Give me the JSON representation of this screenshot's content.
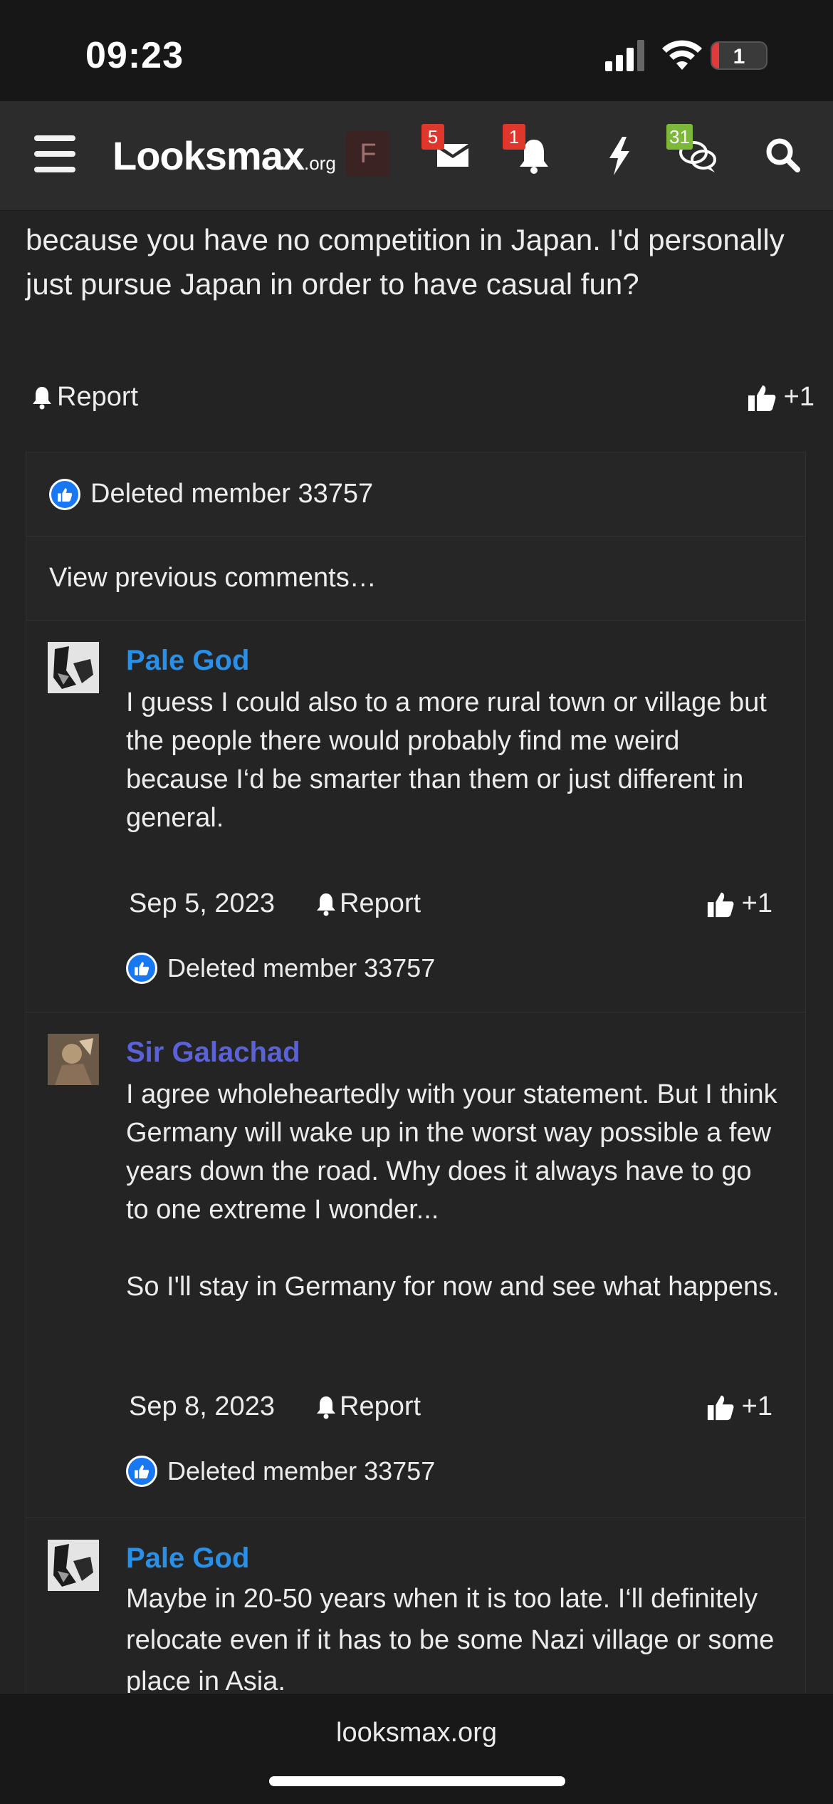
{
  "status_bar": {
    "time": "09:23",
    "battery": "1"
  },
  "nav": {
    "logo_main": "Looksmax",
    "logo_suffix": ".org",
    "avatar_letter": "F",
    "badges": {
      "messages": "5",
      "alerts": "1",
      "new_posts": "31"
    }
  },
  "post": {
    "text": "because you have no competition in Japan. I'd personally just pursue Japan in order to have casual fun?",
    "report_label": "Report",
    "like_count": "+1",
    "liked_by": "Deleted member 33757"
  },
  "comments_section": {
    "view_previous": "View previous comments…",
    "comments": [
      {
        "author": "Pale God",
        "body": "I guess I could also to a more rural town or village but the people there would probably find me weird because I‘d be smarter than them or just different in general.",
        "date": "Sep 5, 2023",
        "report_label": "Report",
        "like_count": "+1",
        "liked_by": "Deleted member 33757"
      },
      {
        "author": "Sir Galachad",
        "body": "I agree wholeheartedly with your statement. But I think Germany will wake up in the worst way possible a few years down the road. Why does it always have to go to one extreme I wonder...\n\nSo I'll stay in Germany for now and see what happens.",
        "date": "Sep 8, 2023",
        "report_label": "Report",
        "like_count": "+1",
        "liked_by": "Deleted member 33757"
      },
      {
        "author": "Pale God",
        "body": "Maybe in 20-50 years when it is too late. I‘ll definitely relocate even if it has to be some Nazi village or some place in Asia."
      }
    ]
  },
  "bottom_bar": {
    "url": "looksmax.org"
  },
  "colors": {
    "background": "#232323",
    "author_blue": "#2a8fe6",
    "author_purple": "#5b62d6",
    "badge_red": "#e0372d",
    "badge_green": "#7cb83a",
    "like_blue": "#1877f2"
  }
}
